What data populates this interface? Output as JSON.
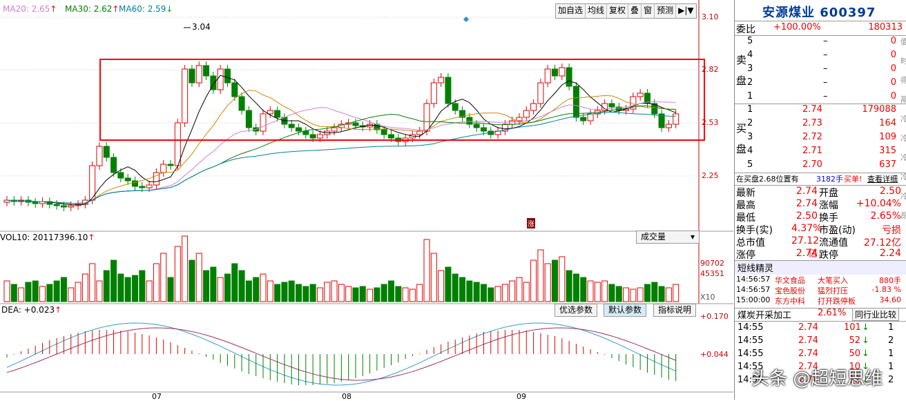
{
  "ma_legend": {
    "ma20": "MA20: 2.65",
    "ma30": "MA30: 2.62",
    "ma60": "MA60: 2.59",
    "arrow_up": "↑",
    "arrow_down": "↓"
  },
  "toolbar": [
    "加自选",
    "均线",
    "复权",
    "叠",
    "窗",
    "预测",
    "▶|▼"
  ],
  "price_axis": [
    "3.10",
    "2.82",
    "2.53",
    "2.25"
  ],
  "peak_label": "3.04",
  "zhang_mark": "涨",
  "vol": {
    "label": "VOL10: 20117396.10",
    "arrow": "↑",
    "dropdown": "成交量",
    "axis": [
      "90702",
      "45351"
    ],
    "x10": "X10"
  },
  "macd": {
    "label": "DEA: +0.023",
    "arrow": "↑",
    "axis": [
      "+0.170",
      "+0.044"
    ],
    "buttons": [
      "优选参数",
      "默认参数",
      "指标说明"
    ]
  },
  "x_axis": [
    "07",
    "08",
    "09"
  ],
  "side": {
    "title": "安源煤业 600397",
    "weibi_label": "委比",
    "weibi_value": "+100.00%",
    "weibi_num": "180313",
    "sell_label": "卖盘",
    "buy_label": "买盘",
    "sell": [
      {
        "lvl": "5",
        "price": "–",
        "vol": "0"
      },
      {
        "lvl": "4",
        "price": "–",
        "vol": "0"
      },
      {
        "lvl": "3",
        "price": "–",
        "vol": "0"
      },
      {
        "lvl": "2",
        "price": "–",
        "vol": "0"
      },
      {
        "lvl": "1",
        "price": "–",
        "vol": "0"
      }
    ],
    "buy": [
      {
        "lvl": "1",
        "price": "2.74",
        "vol": "179088"
      },
      {
        "lvl": "2",
        "price": "2.73",
        "vol": "164"
      },
      {
        "lvl": "3",
        "price": "2.72",
        "vol": "109"
      },
      {
        "lvl": "4",
        "price": "2.71",
        "vol": "315"
      },
      {
        "lvl": "5",
        "price": "2.70",
        "vol": "637"
      }
    ],
    "info_line": {
      "left": "在买盘2.68位置有",
      "mid": "3182手",
      "buy": "买单!",
      "detail": "查看详细"
    },
    "stats": [
      {
        "l": "最新",
        "v": "2.74",
        "l2": "开盘",
        "v2": "2.50"
      },
      {
        "l": "最高",
        "v": "2.74",
        "l2": "涨幅",
        "v2": "+10.04%"
      },
      {
        "l": "最低",
        "v": "2.50",
        "l2": "换手",
        "v2": "2.65%"
      },
      {
        "l": "换手(实)",
        "v": "4.37%",
        "l2": "市盈(动)",
        "v2": "亏损"
      },
      {
        "l": "总市值",
        "v": "27.12亿",
        "l2": "流通值",
        "v2": "27.12亿"
      },
      {
        "l": "涨停",
        "v": "2.74",
        "l2": "跌停",
        "v2": "2.24"
      }
    ],
    "sprite_title": "短线精灵",
    "sprites": [
      {
        "t": "14:56:57",
        "name": "华文食品",
        "act": "大笔买入",
        "val": "880手"
      },
      {
        "t": "14:56:57",
        "name": "宝色股份",
        "act": "猛烈打压",
        "val": "-1.83 %"
      },
      {
        "t": "15:00:00",
        "name": "东方中科",
        "act": "打开跌停板",
        "val": "34.60"
      }
    ],
    "sector": {
      "name": "煤炭开采加工",
      "pct": "2.61%",
      "compare": "同行业比较"
    },
    "ticks": [
      {
        "t": "14:55",
        "p": "2.74",
        "v": "101",
        "d": "1"
      },
      {
        "t": "14:55",
        "p": "2.74",
        "v": "52",
        "d": "2"
      },
      {
        "t": "14:55",
        "p": "2.74",
        "v": "50",
        "d": "1"
      },
      {
        "t": "14:55",
        "p": "2.74",
        "v": "10",
        "d": "1"
      },
      {
        "t": "14:55",
        "p": "2.74",
        "v": "12",
        "d": "2"
      }
    ],
    "right_tabs": [
      "值",
      "时",
      "得",
      "鬲",
      "冷",
      "冷",
      "冷",
      "冷",
      "冷",
      "昂"
    ]
  },
  "watermark": "头条 @超短思维",
  "colors": {
    "up": "#e00000",
    "down": "#008000",
    "box": "#ff0000"
  }
}
